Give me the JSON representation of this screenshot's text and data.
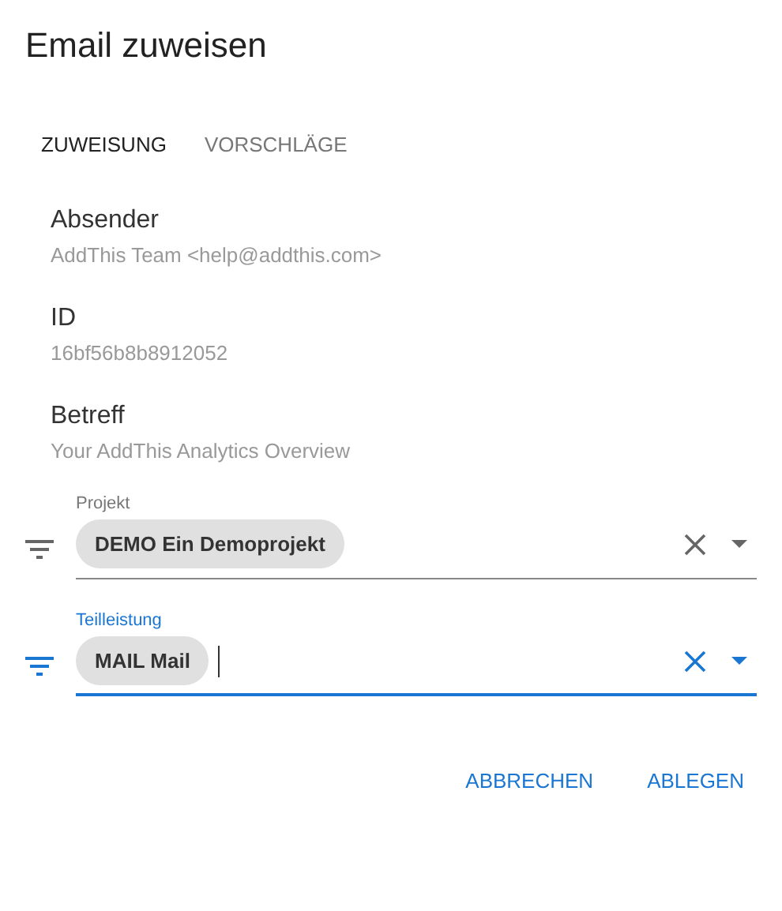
{
  "dialog": {
    "title": "Email zuweisen"
  },
  "tabs": [
    {
      "label": "ZUWEISUNG",
      "selected": true
    },
    {
      "label": "VORSCHLÄGE",
      "selected": false
    }
  ],
  "details": [
    {
      "label": "Absender",
      "value": "AddThis Team <help@addthis.com>"
    },
    {
      "label": "ID",
      "value": "16bf56b8b8912052"
    },
    {
      "label": "Betreff",
      "value": "Your AddThis Analytics Overview"
    }
  ],
  "fields": [
    {
      "label": "Projekt",
      "chip": "DEMO Ein Demoprojekt",
      "focused": false
    },
    {
      "label": "Teilleistung",
      "chip": "MAIL Mail",
      "focused": true
    }
  ],
  "buttons": [
    "ABBRECHEN",
    "ABLEGEN"
  ]
}
